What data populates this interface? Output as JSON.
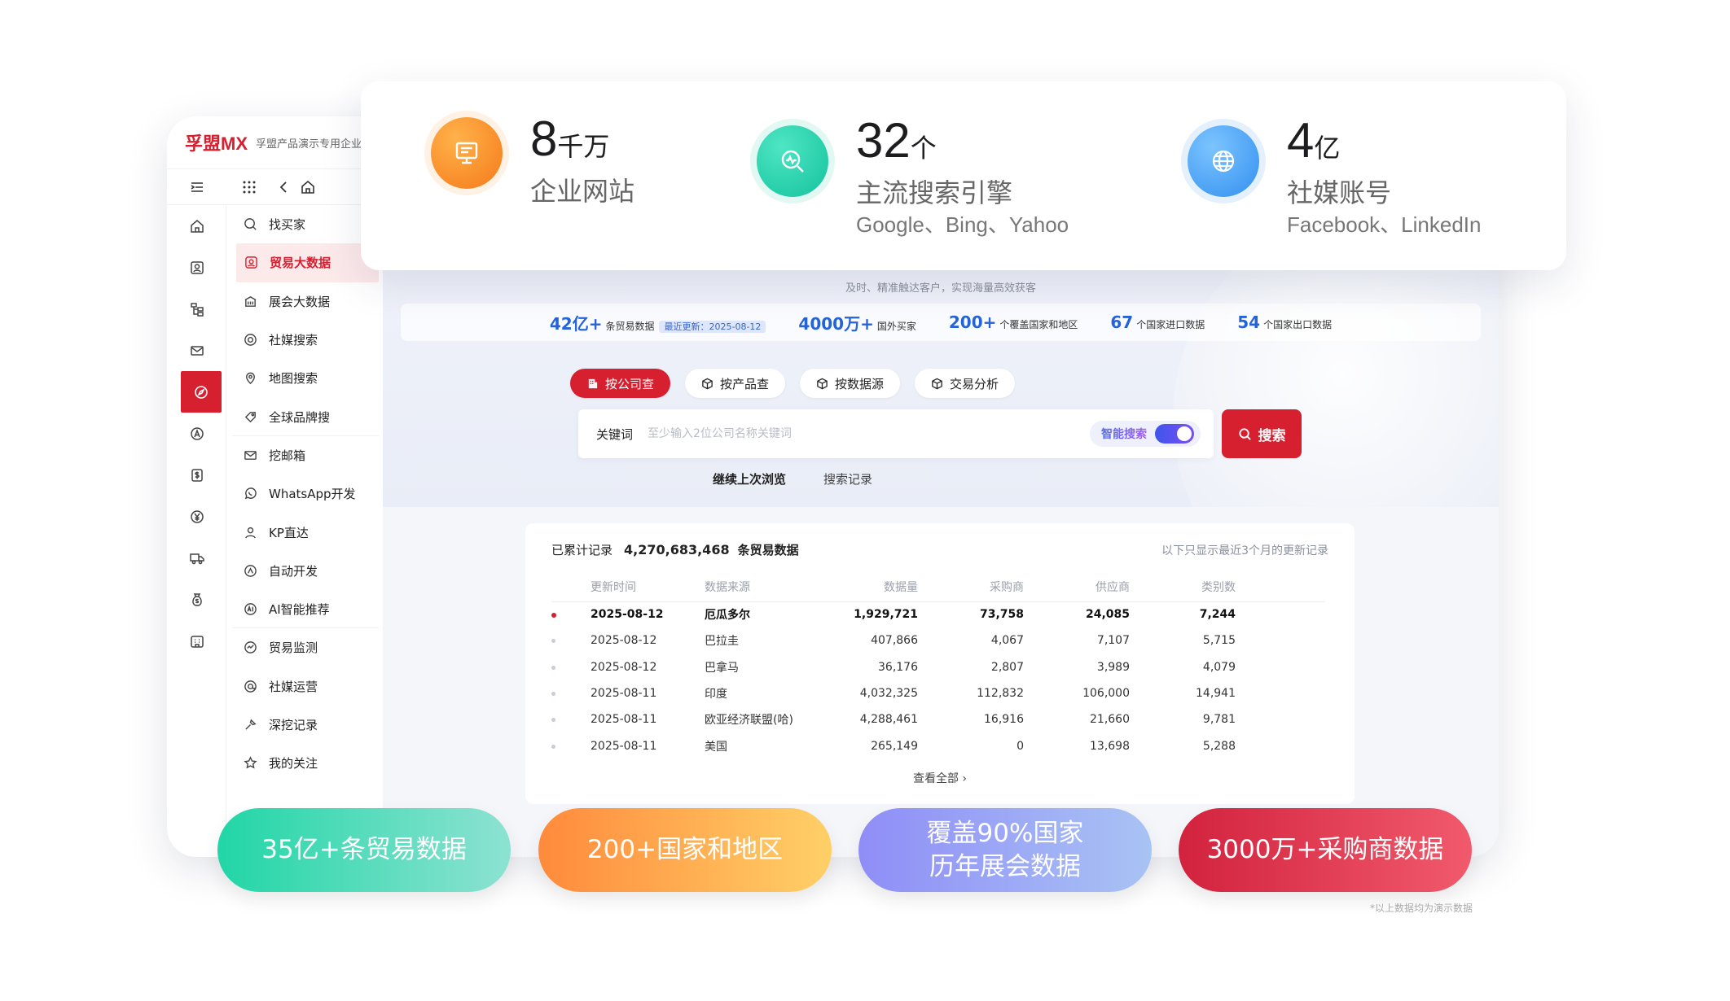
{
  "brand": {
    "logo": "孚盟MX",
    "workspace": "孚盟产品演示专用企业"
  },
  "rail_icons": [
    "home-icon",
    "contact-icon",
    "org-icon",
    "mail-icon",
    "compass-icon",
    "a-icon",
    "dollar-icon",
    "yen-icon",
    "truck-icon",
    "money-bag-icon",
    "building-icon"
  ],
  "menu": {
    "items": [
      {
        "label": "找买家",
        "icon": "search-icon"
      },
      {
        "label": "贸易大数据",
        "icon": "data-icon",
        "active": true
      },
      {
        "label": "展会大数据",
        "icon": "exhibition-icon"
      },
      {
        "label": "社媒搜索",
        "icon": "social-icon"
      },
      {
        "label": "地图搜索",
        "icon": "map-icon"
      },
      {
        "label": "全球品牌搜",
        "icon": "brand-icon"
      },
      {
        "label": "挖邮箱",
        "icon": "mail-icon"
      },
      {
        "label": "WhatsApp开发",
        "icon": "whatsapp-icon"
      },
      {
        "label": "KP直达",
        "icon": "person-icon"
      },
      {
        "label": "自动开发",
        "icon": "auto-icon"
      },
      {
        "label": "AI智能推荐",
        "icon": "ai-icon"
      },
      {
        "label": "贸易监测",
        "icon": "monitor-icon"
      },
      {
        "label": "社媒运营",
        "icon": "social-ops-icon"
      },
      {
        "label": "深挖记录",
        "icon": "dig-icon"
      },
      {
        "label": "我的关注",
        "icon": "star-icon"
      }
    ]
  },
  "hero": {
    "subtitle": "及时、精准触达客户，实现海量高效获客",
    "stats": [
      {
        "num": "42亿+",
        "label": "条贸易数据",
        "badge": "最近更新：2025-08-12"
      },
      {
        "num": "4000万+",
        "label": "国外买家"
      },
      {
        "num": "200+",
        "label": "个覆盖国家和地区"
      },
      {
        "num": "67",
        "label": "个国家进口数据"
      },
      {
        "num": "54",
        "label": "个国家出口数据"
      }
    ],
    "tabs": [
      "按公司查",
      "按产品查",
      "按数据源",
      "交易分析"
    ],
    "search": {
      "label": "关键词",
      "placeholder": "至少输入2位公司名称关键词",
      "smart": "智能搜索",
      "button": "搜索"
    },
    "history": [
      "继续上次浏览",
      "搜索记录"
    ]
  },
  "records": {
    "title": "已累计记录",
    "count": "4,270,683,468",
    "unit": "条贸易数据",
    "note": "以下只显示最近3个月的更新记录",
    "columns": [
      "更新时间",
      "数据来源",
      "数据量",
      "采购商",
      "供应商",
      "类别数"
    ],
    "rows": [
      [
        "2025-08-12",
        "厄瓜多尔",
        "1,929,721",
        "73,758",
        "24,085",
        "7,244"
      ],
      [
        "2025-08-12",
        "巴拉圭",
        "407,866",
        "4,067",
        "7,107",
        "5,715"
      ],
      [
        "2025-08-12",
        "巴拿马",
        "36,176",
        "2,807",
        "3,989",
        "4,079"
      ],
      [
        "2025-08-11",
        "印度",
        "4,032,325",
        "112,832",
        "106,000",
        "14,941"
      ],
      [
        "2025-08-11",
        "欧亚经济联盟(哈)",
        "4,288,461",
        "16,916",
        "21,660",
        "9,781"
      ],
      [
        "2025-08-11",
        "美国",
        "265,149",
        "0",
        "13,698",
        "5,288"
      ]
    ],
    "view_all": "查看全部 ›"
  },
  "top_stats": [
    {
      "num": "8",
      "unit": "千万",
      "label": "企业网站",
      "sub": "",
      "color": "#f7861f"
    },
    {
      "num": "32",
      "unit": "个",
      "label": "主流搜索引擎",
      "sub": "Google、Bing、Yahoo",
      "color": "#1fcfa8"
    },
    {
      "num": "4",
      "unit": "亿",
      "label": "社媒账号",
      "sub": "Facebook、LinkedIn",
      "color": "#3b9bf1"
    }
  ],
  "pills": [
    {
      "line1": "35亿+条贸易数据",
      "line2": ""
    },
    {
      "line1": "200+国家和地区",
      "line2": ""
    },
    {
      "line1": "覆盖90%国家",
      "line2": "历年展会数据"
    },
    {
      "line1": "3000万+采购商数据",
      "line2": ""
    }
  ],
  "footnote": "*以上数据均为演示数据"
}
